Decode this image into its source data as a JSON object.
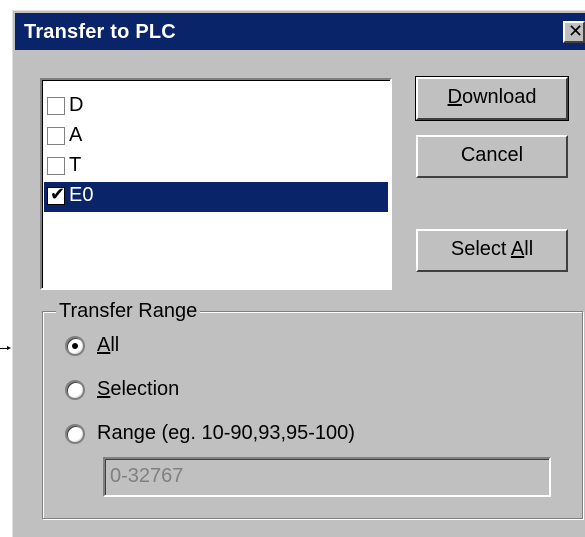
{
  "dialog": {
    "title": "Transfer to PLC",
    "close_glyph": "✕"
  },
  "list": {
    "items": [
      {
        "label": "D",
        "checked": false,
        "selected": false
      },
      {
        "label": "A",
        "checked": false,
        "selected": false
      },
      {
        "label": "T",
        "checked": false,
        "selected": false
      },
      {
        "label": "E0",
        "checked": true,
        "selected": true
      }
    ],
    "check_glyph": "✔"
  },
  "buttons": {
    "download": {
      "accel": "D",
      "rest": "ownload"
    },
    "cancel": {
      "label": "Cancel"
    },
    "select_all": {
      "prefix": "Select ",
      "accel": "A",
      "rest": "ll"
    }
  },
  "transfer_range": {
    "title": "Transfer Range",
    "options": [
      {
        "accel": "A",
        "rest": "ll",
        "selected": true
      },
      {
        "accel": "S",
        "rest": "election",
        "selected": false
      },
      {
        "label": "Range (eg. 10-90,93,95-100)",
        "selected": false
      }
    ],
    "range_value": "0-32767"
  },
  "colors": {
    "titlebar": "#0a246a",
    "face": "#c0c0c0",
    "selection": "#0a246a"
  }
}
